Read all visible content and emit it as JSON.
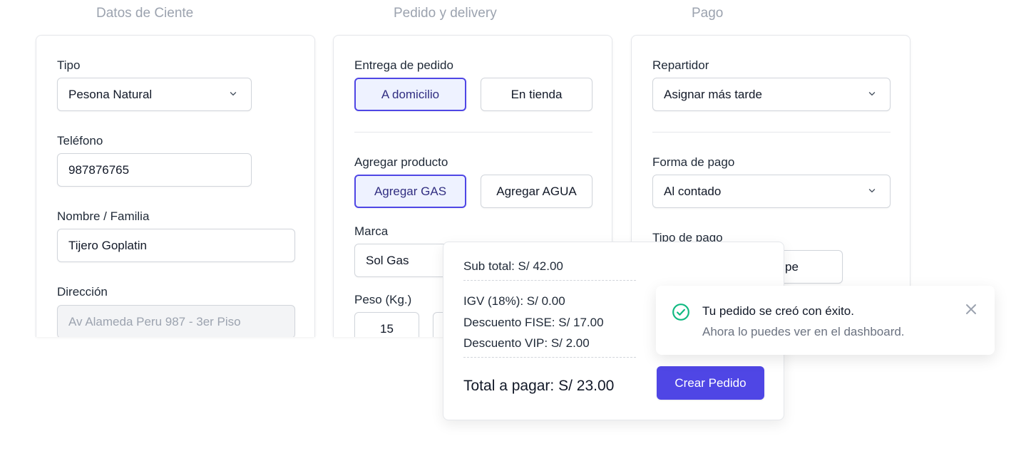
{
  "columns": {
    "cliente": "Datos de Ciente",
    "pedido": "Pedido y delivery",
    "pago": "Pago"
  },
  "cliente": {
    "tipo_label": "Tipo",
    "tipo_value": "Pesona Natural",
    "telefono_label": "Teléfono",
    "telefono_value": "987876765",
    "nombre_label": "Nombre / Familia",
    "nombre_value": "Tijero Goplatin",
    "direccion_label": "Dirección",
    "direccion_placeholder": "Av Alameda Peru 987 - 3er Piso"
  },
  "pedido": {
    "entrega_label": "Entrega de pedido",
    "entrega_options": [
      "A domicilio",
      "En tienda"
    ],
    "entrega_selected": "A domicilio",
    "producto_label": "Agregar producto",
    "producto_options": [
      "Agregar GAS",
      "Agregar AGUA"
    ],
    "producto_selected": "Agregar GAS",
    "marca_label": "Marca",
    "marca_value": "Sol Gas",
    "peso_label": "Peso (Kg.)",
    "peso_value": "15"
  },
  "pago": {
    "repartidor_label": "Repartidor",
    "repartidor_value": "Asignar más tarde",
    "forma_label": "Forma de pago",
    "forma_value": "Al contado",
    "tipo_label": "Tipo de pago",
    "tipo_value_partial": "pe"
  },
  "summary": {
    "subtotal": "Sub total: S/ 42.00",
    "igv": "IGV (18%): S/ 0.00",
    "fise": "Descuento FISE: S/ 17.00",
    "vip": "Descuento VIP: S/ 2.00",
    "total": "Total a pagar: S/ 23.00",
    "create_label": "Crear Pedido"
  },
  "toast": {
    "title": "Tu pedido se creó con éxito.",
    "message": "Ahora lo puedes ver en el dashboard.",
    "icon": "check-circle-icon"
  },
  "colors": {
    "accent": "#4f46e5",
    "accent_light": "#eef2ff",
    "success": "#10b981",
    "muted": "#9ca3af"
  }
}
